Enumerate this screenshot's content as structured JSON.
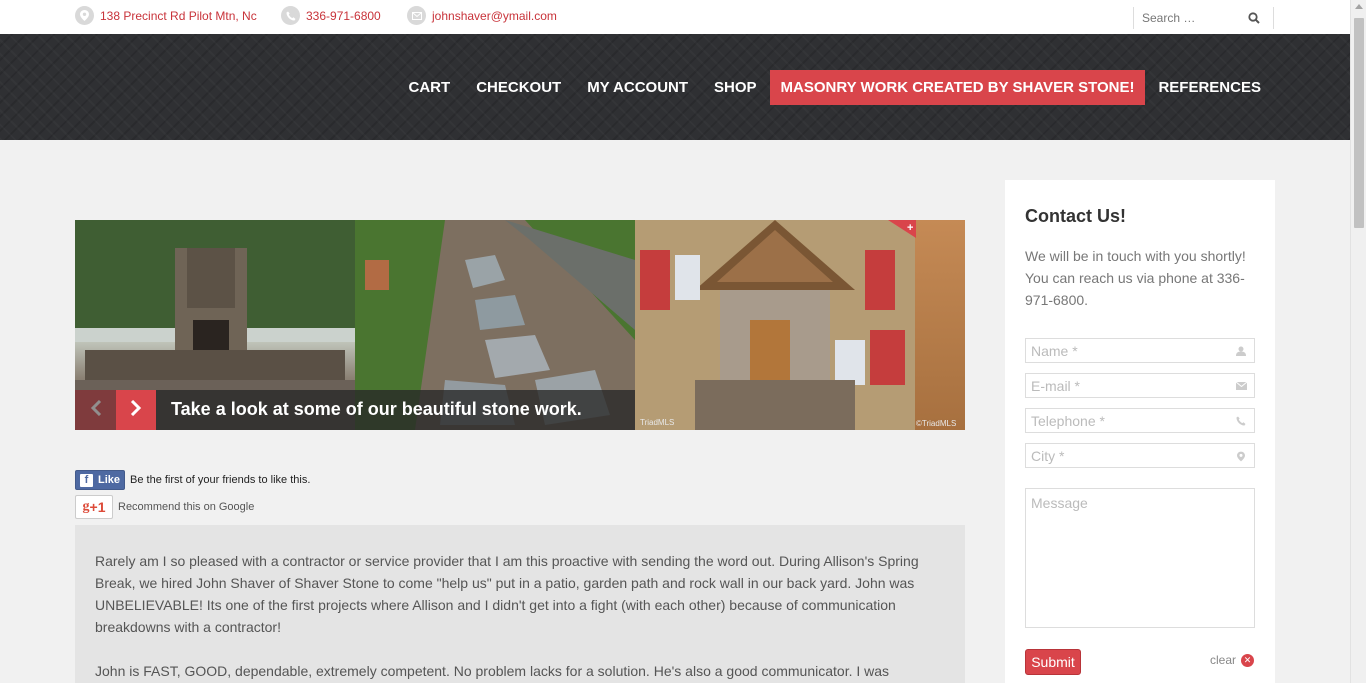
{
  "topbar": {
    "address": "138 Precinct Rd Pilot Mtn, Nc",
    "phone": "336-971-6800",
    "email": "johnshaver@ymail.com",
    "search_placeholder": "Search …"
  },
  "nav": {
    "items": [
      {
        "label": "CART",
        "active": false
      },
      {
        "label": "CHECKOUT",
        "active": false
      },
      {
        "label": "MY ACCOUNT",
        "active": false
      },
      {
        "label": "SHOP",
        "active": false
      },
      {
        "label": "MASONRY WORK CREATED BY SHAVER STONE!",
        "active": true
      },
      {
        "label": "REFERENCES",
        "active": false
      }
    ]
  },
  "slider": {
    "caption": "Take a look at some of our beautiful stone work.",
    "credit_1": "TriadMLS",
    "credit_2": "©TriadMLS"
  },
  "social": {
    "fb_label": "Like",
    "fb_text": "Be the first of your friends to like this.",
    "gplus_label": "+1",
    "gplus_text": "Recommend this on Google"
  },
  "testimonial": {
    "paragraph_1": "Rarely am I so pleased with a contractor or service provider that I am this proactive with sending the word out. During Allison's Spring Break, we hired John Shaver of Shaver Stone to come \"help us\" put in a patio, garden path and rock wall in our back yard. John was UNBELIEVABLE! Its one of the first projects where Allison and I didn't get into a fight (with each other) because of communication breakdowns with a contractor!",
    "paragraph_2": "John is FAST, GOOD, dependable, extremely competent. No problem lacks for a solution. He's also a good communicator. I was"
  },
  "sidebar": {
    "title": "Contact Us!",
    "text": "We will be in touch with you shortly! You can reach us via phone at 336-971-6800.",
    "name_placeholder": "Name *",
    "email_placeholder": "E-mail *",
    "phone_placeholder": "Telephone *",
    "city_placeholder": "City *",
    "message_placeholder": "Message",
    "submit_label": "Submit",
    "clear_label": "clear"
  },
  "colors": {
    "accent": "#d9454b",
    "header_bg": "#2f3033",
    "page_bg": "#f1f1f1"
  }
}
